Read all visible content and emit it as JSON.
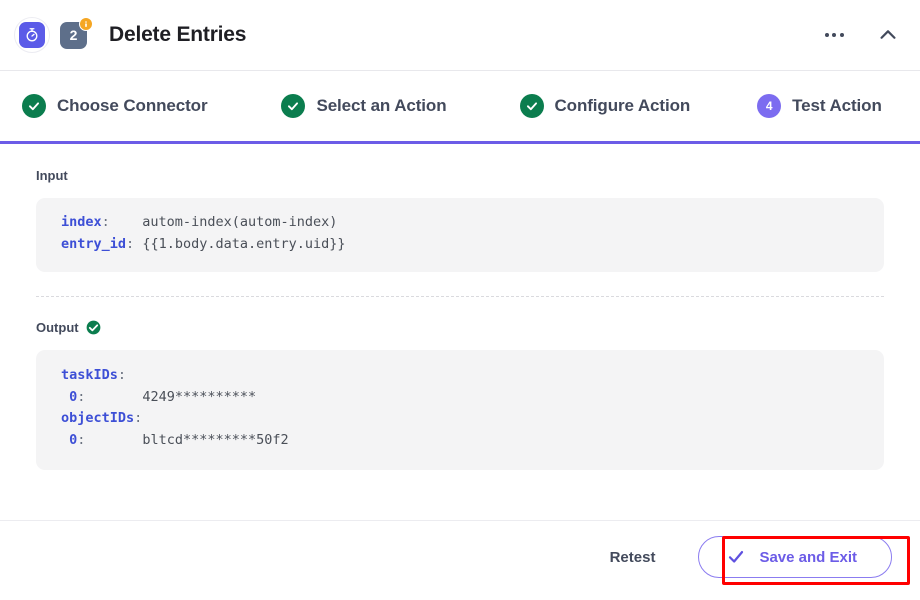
{
  "header": {
    "title": "Delete Entries",
    "app_icon": "stopwatch-icon",
    "step_number": "2",
    "badge_icon": "info-badge-icon",
    "more_icon": "ellipsis-icon",
    "collapse_icon": "chevron-up-icon"
  },
  "steps": [
    {
      "label": "Choose Connector",
      "state": "done",
      "marker": "check-icon"
    },
    {
      "label": "Select an Action",
      "state": "done",
      "marker": "check-icon"
    },
    {
      "label": "Configure Action",
      "state": "done",
      "marker": "check-icon"
    },
    {
      "label": "Test Action",
      "state": "current",
      "marker": "4"
    }
  ],
  "input": {
    "label": "Input",
    "rows": [
      {
        "key": "index",
        "colon": ":",
        "value": "autom-index(autom-index)"
      },
      {
        "key": "entry_id",
        "colon": ":",
        "value": "{{1.body.data.entry.uid}}"
      }
    ]
  },
  "output": {
    "label": "Output",
    "status_icon": "check-circle-icon",
    "rows": [
      {
        "key": "taskIDs",
        "colon": ":",
        "value": ""
      },
      {
        "key": "0",
        "colon": ":",
        "value": "4249**********",
        "indent": true
      },
      {
        "key": "objectIDs",
        "colon": ":",
        "value": ""
      },
      {
        "key": "0",
        "colon": ":",
        "value": "bltcd*********50f2",
        "indent": true
      }
    ]
  },
  "footer": {
    "retest_label": "Retest",
    "save_label": "Save and Exit",
    "save_icon": "check-icon"
  },
  "colors": {
    "accent_purple": "#6C5CE7",
    "app_icon_purple": "#5B5BE8",
    "step_done_green": "#0B7D4E",
    "step_current_purple": "#7C6CF0",
    "badge_orange": "#F5A623",
    "chip_slate": "#5e6f8a",
    "code_key_blue": "#3d4fd6",
    "code_bg": "#f4f4f5",
    "text_dark": "#434A5C",
    "annotation_red": "#FF0000"
  }
}
